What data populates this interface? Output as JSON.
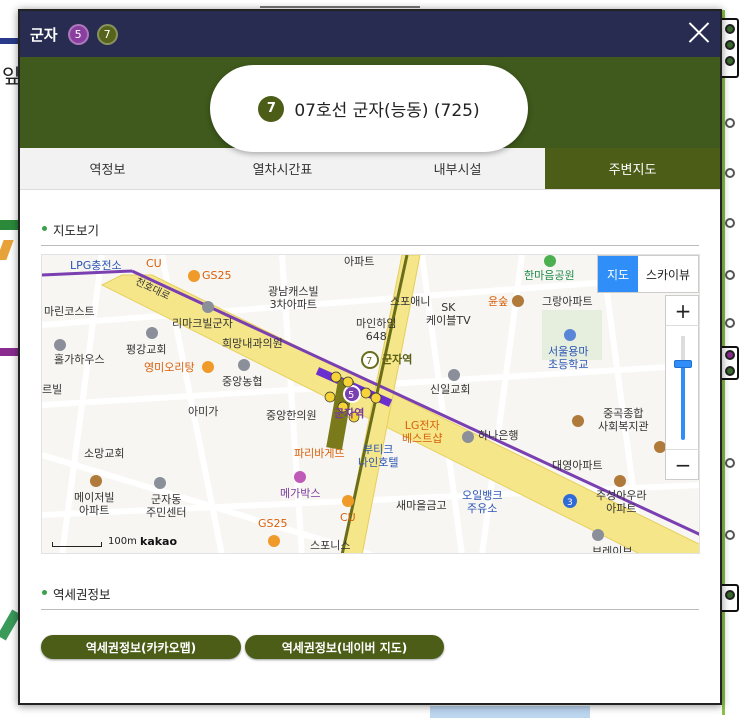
{
  "popup": {
    "title": "군자",
    "lines": [
      {
        "number": "5",
        "color": "#8a3fa0"
      },
      {
        "number": "7",
        "color": "#55641a"
      }
    ],
    "close_icon": "close-icon",
    "banner": {
      "line_number": "7",
      "station_name": "07호선 군자(능동) (725)"
    }
  },
  "tabs": [
    {
      "label": "역정보",
      "active": false
    },
    {
      "label": "열차시간표",
      "active": false
    },
    {
      "label": "내부시설",
      "active": false
    },
    {
      "label": "주변지도",
      "active": true
    }
  ],
  "map_section": {
    "title": "지도보기",
    "map_type": {
      "map": "지도",
      "skyview": "스카이뷰"
    },
    "zoom": {
      "plus": "+",
      "minus": "−"
    },
    "scale_label": "100m",
    "provider": "kakao",
    "labels": {
      "l1": "LPG충전소",
      "l2": "CU",
      "l3": "GS25",
      "l4": "광남캐스빌",
      "l5": "3차아파트",
      "l6": "아파트",
      "l7": "스포애니",
      "l8": "SK",
      "l9": "케이블TV",
      "l10": "윤숲",
      "l11": "한마음공원",
      "l12": "그랑아파트",
      "l13": "마린코스트",
      "l14": "리마크빌군자",
      "l15": "희망내과의원",
      "l16": "마인하임",
      "l17": "648",
      "l18": "평강교회",
      "l19": "영미오리탕",
      "l20": "서울용마",
      "l21": "초등학교",
      "l22": "홀가하우스",
      "l23": "중앙농협",
      "l24": "군자역",
      "l25": "신일교회",
      "l26": "아미가",
      "l27": "중앙한의원",
      "l28": "군자역",
      "l29": "LG전자",
      "l30": "베스트샵",
      "l31": "하나은행",
      "l32": "중곡종합",
      "l33": "사회복지관",
      "l34": "소망교회",
      "l35": "파리바게뜨",
      "l36": "부티크",
      "l37": "나인호텔",
      "l38": "대영아파트",
      "l39": "메이저빌",
      "l40": "아파트",
      "l41": "군자동",
      "l42": "주민센터",
      "l43": "메가박스",
      "l44": "새마을금고",
      "l45": "오일뱅크",
      "l46": "주유소",
      "l47": "주성아우라",
      "l48": "아파트",
      "l49": "GS25",
      "l50": "CU",
      "l51": "스포니스",
      "l52": "브레이브",
      "l53": "천호대로",
      "l54": "르빌",
      "l55": "군자"
    },
    "markers": {
      "line7": "7",
      "line5": "5",
      "line3": "3"
    }
  },
  "influence_section": {
    "title": "역세권정보",
    "buttons": [
      "역세권정보(카카오맵)",
      "역세권정보(네이버 지도)"
    ]
  },
  "background": {
    "left_text": "잎"
  }
}
